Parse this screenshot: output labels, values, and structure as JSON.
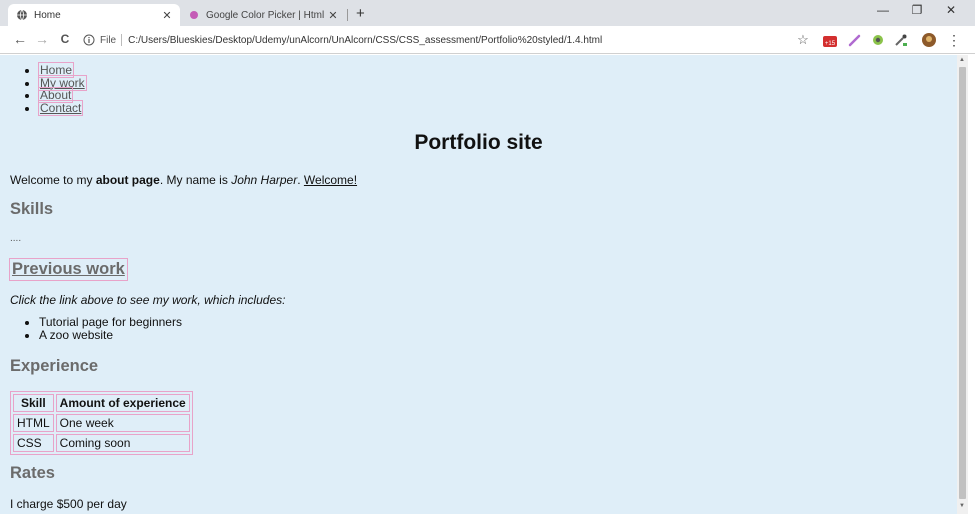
{
  "browser": {
    "tabs": [
      {
        "title": "Home",
        "active": true
      },
      {
        "title": "Google Color Picker | Html Color",
        "active": false
      }
    ],
    "new_tab": "+",
    "tab_close": "✕",
    "window_controls": {
      "minimize": "—",
      "restore": "❐",
      "close": "✕"
    },
    "nav": {
      "back": "←",
      "forward": "→",
      "reload": "C"
    },
    "address": {
      "scheme_label": "File",
      "url": "C:/Users/Blueskies/Desktop/Udemy/unAlcorn/UnAlcorn/CSS/CSS_assessment/Portfolio%20styled/1.4.html"
    },
    "extensions": [
      "star-icon",
      "youtube-badge-icon",
      "pen-icon",
      "eye-icon",
      "eyedropper-icon",
      "avatar-icon",
      "more-icon"
    ],
    "badge_count": "+15",
    "more_label": "⋮",
    "star_label": "☆"
  },
  "page": {
    "nav_items": [
      "Home",
      "My work",
      "About",
      "Contact"
    ],
    "title": "Portfolio site",
    "intro": {
      "text1": "Welcome to my ",
      "bold": "about page",
      "text2": ". My name is ",
      "italic": "John Harper",
      "text3": ". ",
      "link": "Welcome!"
    },
    "skills_heading": "Skills",
    "skills_text": "....",
    "previous_work_link": "Previous work",
    "click_note": "Click the link above to see my work, which includes:",
    "work_items": [
      "Tutorial page for beginners",
      "A zoo website"
    ],
    "experience_heading": "Experience",
    "experience_table": {
      "headers": [
        "Skill",
        "Amount of experience"
      ],
      "rows": [
        [
          "HTML",
          "One week"
        ],
        [
          "CSS",
          "Coming soon"
        ]
      ]
    },
    "rates_heading": "Rates",
    "rates_text": "I charge $500 per day"
  },
  "colors": {
    "page_background": "#dfeef8",
    "outline_pink": "#e8a3c9",
    "heading_gray": "#6b6b6b"
  }
}
